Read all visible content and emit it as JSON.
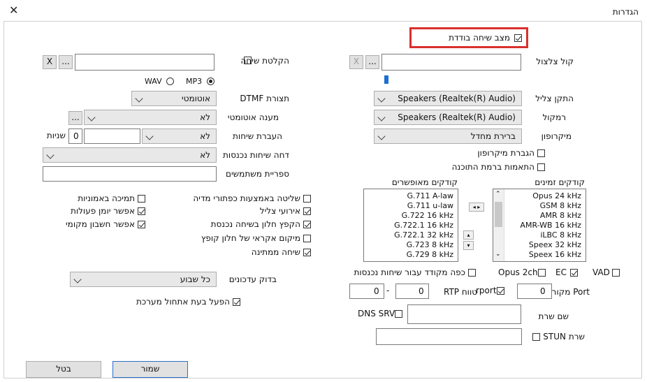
{
  "window": {
    "title": "הגדרות",
    "close_glyph": "✕"
  },
  "single_call": {
    "label": "מצב שיחה בודדת",
    "checked": true,
    "highlight_color": "#d9302c"
  },
  "ringtone": {
    "label": "קול צלצול",
    "path": "",
    "browse": "...",
    "clear": "X"
  },
  "call_recording": {
    "label": "הקלטת שיחה",
    "checked": false,
    "path": "",
    "browse": "...",
    "clear": "X",
    "format_wav": "WAV",
    "format_mp3": "MP3",
    "selected_format": "MP3"
  },
  "ring_device": {
    "label": "התקן צליל",
    "value": "Speakers (Realtek(R) Audio)"
  },
  "speaker": {
    "label": "רמקול",
    "value": "Speakers (Realtek(R) Audio)"
  },
  "microphone": {
    "label": "מיקרופון",
    "value": "ברירת מחדל"
  },
  "mic_amplify": {
    "label": "הגברת מיקרופון",
    "checked": false
  },
  "software_level_adjust": {
    "label": "התאמות ברמת התוכנה",
    "checked": false
  },
  "dtmf": {
    "label": "תצורת DTMF",
    "value": "אוטומטי"
  },
  "auto_answer": {
    "label": "מענה אוטומטי",
    "value": "לא",
    "browse": "..."
  },
  "forwarding": {
    "label": "העברת שיחות",
    "value": "לא",
    "seconds_value": "0",
    "seconds_unit": "שניות"
  },
  "reject_incoming": {
    "label": "דחה שיחות נכנסות",
    "value": "לא"
  },
  "user_directory": {
    "label": "ספריית משתמשים",
    "value": ""
  },
  "codecs": {
    "available_label": "קודקים זמינים",
    "enabled_label": "קודקים מאופשרים",
    "available": [
      "Opus 24 kHz",
      "GSM 8 kHz",
      "AMR 8 kHz",
      "AMR-WB 16 kHz",
      "iLBC 8 kHz",
      "Speex 32 kHz",
      "Speex 16 kHz"
    ],
    "enabled": [
      "G.711 A-law",
      "G.711 u-law",
      "G.722 16 kHz",
      "G.722.1 16 kHz",
      "G.722.1 32 kHz",
      "G.723 8 kHz",
      "G.729 8 kHz"
    ]
  },
  "media_keys": {
    "label": "שליטה באמצעות כפתורי מדיה",
    "checked": false
  },
  "ring_events": {
    "label": "אירועי צליל",
    "checked": true
  },
  "popup_incoming": {
    "label": "הקפץ חלון בשיחה נכנסת",
    "checked": true
  },
  "random_position": {
    "label": "מיקום אקראי של חלון קופץ",
    "checked": false
  },
  "call_waiting": {
    "label": "שיחה ממתינה",
    "checked": true
  },
  "emoji_support": {
    "label": "תמיכה באמוניות",
    "checked": false
  },
  "activity_log": {
    "label": "אפשר יומן פעולות",
    "checked": true
  },
  "local_account": {
    "label": "אפשר חשבון מקומי",
    "checked": true
  },
  "updates": {
    "label": "בדוק עדכונים",
    "value": "כל שבוע"
  },
  "run_on_startup": {
    "label": "הפעל בעת אתחול מערכת",
    "checked": true
  },
  "incoming_codec_button": {
    "label": "כפה מקודד עבור שיחות נכנסות",
    "checked": false
  },
  "opus_2ch": {
    "label": "Opus 2ch",
    "checked": false
  },
  "ec": {
    "label": "EC",
    "checked": true
  },
  "vad": {
    "label": "VAD",
    "checked": false
  },
  "source_port": {
    "label": "Port מקור",
    "value": "0"
  },
  "rport": {
    "label": "rport",
    "checked": true
  },
  "rtp_range": {
    "label": "טווח RTP",
    "from": "0",
    "to": "0",
    "sep": "-"
  },
  "server_name": {
    "label": "שם שרת",
    "value": ""
  },
  "dns_srv": {
    "label": "DNS SRV",
    "checked": false
  },
  "stun": {
    "label": "שרת STUN",
    "checked": false,
    "value": ""
  },
  "footer": {
    "save": "שמור",
    "cancel": "בטל"
  }
}
